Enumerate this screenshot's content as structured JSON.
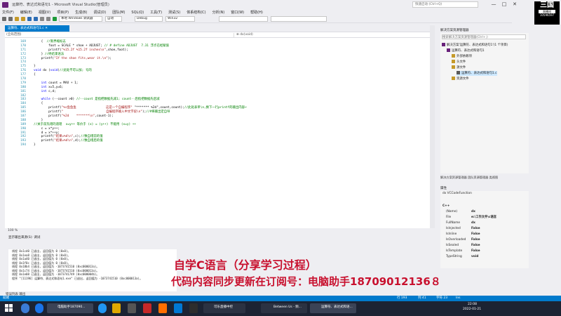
{
  "window": {
    "title": "运算符、表达式和语句1 - Microsoft Visual Studio(管理员)",
    "quick_launch_placeholder": "快速启动 (Ctrl+Q)",
    "min": "—",
    "max": "□",
    "close": "✕"
  },
  "menu": [
    "文件(F)",
    "编辑(E)",
    "视图(V)",
    "项目(P)",
    "生成(B)",
    "调试(D)",
    "团队(M)",
    "SQL(Q)",
    "工具(T)",
    "测试(S)",
    "体系结构(C)",
    "分析(N)",
    "窗口(W)",
    "帮助(H)"
  ],
  "toolbar": {
    "target": "本地 Windows 调试器",
    "mode": "自动",
    "config": "Debug",
    "platform": "Win32"
  },
  "logo": {
    "big": "三国",
    "small": "直播间",
    "num": "10596597"
  },
  "editor": {
    "tab_label": "运算符、表达式和语句1.c ✕",
    "nav_left": "(全局范围)",
    "nav_right": "⊕ dx(void)",
    "zoom": "100 %",
    "lines": [
      {
        "n": "169",
        "segs": [
          {
            "c": "",
            "t": "    {  "
          },
          {
            "c": "cm",
            "t": "//限界缩标志"
          }
        ]
      },
      {
        "n": "170",
        "segs": [
          {
            "c": "",
            "t": "        foot = SCALE * shoe + ADJUST; "
          },
          {
            "c": "cm",
            "t": "// # define ADJUST  7.31 浮点已经赋值"
          }
        ]
      },
      {
        "n": "171",
        "segs": [
          {
            "c": "",
            "t": "        printf("
          },
          {
            "c": "st",
            "t": "\"%15.2f %15.2f inches\\n\""
          },
          {
            "c": "",
            "t": ",shoe,foot);"
          }
        ]
      },
      {
        "n": "172",
        "segs": [
          {
            "c": "",
            "t": "    } "
          },
          {
            "c": "cm",
            "t": "//终结束语法"
          }
        ]
      },
      {
        "n": "173",
        "segs": [
          {
            "c": "",
            "t": "    printf("
          },
          {
            "c": "st",
            "t": "\"If the shoe fits,wear it.\\n\""
          },
          {
            "c": "",
            "t": ");"
          }
        ]
      },
      {
        "n": "174",
        "segs": [
          {
            "c": "",
            "t": ""
          }
        ]
      },
      {
        "n": "175",
        "segs": [
          {
            "c": "",
            "t": "}"
          }
        ]
      },
      {
        "n": "176",
        "segs": [
          {
            "c": "kw",
            "t": "void"
          },
          {
            "c": "",
            "t": " dx ("
          },
          {
            "c": "kw",
            "t": "void"
          },
          {
            "c": "",
            "t": ")"
          },
          {
            "c": "cm",
            "t": "//此处不可以加; 号的"
          }
        ]
      },
      {
        "n": "177",
        "segs": [
          {
            "c": "",
            "t": "{"
          }
        ]
      },
      {
        "n": "178",
        "segs": [
          {
            "c": "",
            "t": ""
          }
        ]
      },
      {
        "n": "179",
        "segs": [
          {
            "c": "",
            "t": "    "
          },
          {
            "c": "kw",
            "t": "int"
          },
          {
            "c": "",
            "t": " count = MAX + 1;"
          }
        ]
      },
      {
        "n": "180",
        "segs": [
          {
            "c": "",
            "t": "    "
          },
          {
            "c": "kw",
            "t": "int"
          },
          {
            "c": "",
            "t": " x=5,y=6;"
          }
        ]
      },
      {
        "n": "181",
        "segs": [
          {
            "c": "",
            "t": "    "
          },
          {
            "c": "kw",
            "t": "int"
          },
          {
            "c": "",
            "t": " c,d;"
          }
        ]
      },
      {
        "n": "182",
        "segs": [
          {
            "c": "",
            "t": ""
          }
        ]
      },
      {
        "n": "183",
        "segs": [
          {
            "c": "",
            "t": "    "
          },
          {
            "c": "kw",
            "t": "while"
          },
          {
            "c": "",
            "t": " (--count >0) "
          },
          {
            "c": "cm",
            "t": "//--count 是指把数据先减1; count--后指把数据先后减"
          }
        ]
      },
      {
        "n": "184",
        "segs": [
          {
            "c": "",
            "t": "    {"
          }
        ]
      },
      {
        "n": "185",
        "segs": [
          {
            "c": "",
            "t": "        printf("
          },
          {
            "c": "st",
            "t": "\"%s鱼鱼鱼                这是一个自编程序\""
          },
          {
            "c": "",
            "t": " \"******* %2d\",count,count);"
          },
          {
            "c": "cm",
            "t": "//此处表单\\n,换下一行printf的输出内容↩"
          }
        ]
      },
      {
        "n": "186",
        "segs": [
          {
            "c": "",
            "t": "        printf("
          },
          {
            "c": "st",
            "t": "\"                       自编程序输入中文字段\\n\""
          },
          {
            "c": "",
            "t": ");"
          },
          {
            "c": "cm",
            "t": "//#将输出定自导"
          }
        ]
      },
      {
        "n": "187",
        "segs": [
          {
            "c": "",
            "t": "        printf("
          },
          {
            "c": "st",
            "t": "\"%2d    *******\\n\""
          },
          {
            "c": "",
            "t": ",count-1);"
          }
        ]
      },
      {
        "n": "188",
        "segs": [
          {
            "c": "",
            "t": "    }"
          }
        ]
      },
      {
        "n": "189",
        "segs": [
          {
            "c": "cm",
            "t": "//关于前先增的道理  x=y++ 等价于 (x) = (y++) 不能用 (x=y) ++"
          }
        ]
      },
      {
        "n": "190",
        "segs": [
          {
            "c": "",
            "t": "    c = x*y++;"
          }
        ]
      },
      {
        "n": "191",
        "segs": [
          {
            "c": "",
            "t": "    d = x*++y;"
          }
        ]
      },
      {
        "n": "192",
        "segs": [
          {
            "c": "",
            "t": "    printf("
          },
          {
            "c": "st",
            "t": "\"结果=%d\\n\""
          },
          {
            "c": "",
            "t": ",c);"
          },
          {
            "c": "cm",
            "t": "//数自增前的值"
          }
        ]
      },
      {
        "n": "193",
        "segs": [
          {
            "c": "",
            "t": "    printf("
          },
          {
            "c": "st",
            "t": "\"结果=%d\\n\""
          },
          {
            "c": "",
            "t": ",d);"
          },
          {
            "c": "cm",
            "t": "//数自增后的值"
          }
        ]
      },
      {
        "n": "194",
        "segs": [
          {
            "c": "",
            "t": "}"
          }
        ]
      }
    ]
  },
  "output": {
    "title": "显示输出来源(S): 调试",
    "source": "调试",
    "lines": [
      "线程 0x1cd0 已退出, 返回值为 0 (0x0)。",
      "线程 0x1ea8 已退出, 返回值为 0 (0x0)。",
      "线程 0x1a40 已退出, 返回值为 0 (0x0)。",
      "线程 0x1f0c 已退出, 返回值为 0 (0x0)。",
      "线程 0x18b4 已退出, 返回值为 -1073741510 (0xc000013a)。",
      "线程 0x1c74 已退出, 返回值为 -1073741510 (0xc000013a)。",
      "线程 0x1e08 已退出, 返回值为 -1073741749 (0xc000004b)。",
      "程序 \"[11196] 运算符、表达式和语句1.exe\" 已退出, 返回值为 -1073741510 (0xc000013a)。"
    ],
    "tabs": "错误列表  输出"
  },
  "solution": {
    "header": "解决方案资源管理器",
    "search": "搜索解决方案资源管理器(Ctrl+;)",
    "items": [
      {
        "label": "解决方案'运算符、表达式和语句1'(1 个项目)",
        "indent": 0,
        "color": "#68217a"
      },
      {
        "label": "运算符、表达式和语句1",
        "indent": 1,
        "color": "#68217a"
      },
      {
        "label": "外部依赖项",
        "indent": 2,
        "color": "#c59a2a"
      },
      {
        "label": "头文件",
        "indent": 2,
        "color": "#c59a2a"
      },
      {
        "label": "源文件",
        "indent": 2,
        "color": "#c59a2a"
      },
      {
        "label": "运算符、表达式和语句1.c",
        "indent": 3,
        "color": "#5a5a5a",
        "selected": true
      },
      {
        "label": "资源文件",
        "indent": 2,
        "color": "#c59a2a"
      }
    ],
    "tabs": "解决方案资源管理器  团队资源管理器  类视图"
  },
  "properties": {
    "header": "属性",
    "object": "dx VCCodeFunction",
    "category": "C++",
    "rows": [
      {
        "k": "(Name)",
        "v": "dx"
      },
      {
        "k": "File",
        "v": "e:\\工作文件\\c语言"
      },
      {
        "k": "FullName",
        "v": "dx"
      },
      {
        "k": "IsInjected",
        "v": "False"
      },
      {
        "k": "IsInline",
        "v": "False"
      },
      {
        "k": "IsOverloaded",
        "v": "False"
      },
      {
        "k": "IsSealed",
        "v": "False"
      },
      {
        "k": "IsTemplate",
        "v": "False"
      },
      {
        "k": "TypeString",
        "v": "void"
      }
    ]
  },
  "statusbar": {
    "left": "就绪",
    "line": "行 193",
    "col": "列 41",
    "ch": "字符 23",
    "ins": "Ins"
  },
  "taskbar": {
    "items": [
      {
        "label": "电脑助手187090..."
      },
      {
        "label": "可乐直播中控"
      },
      {
        "label": "Between Us - 频..."
      },
      {
        "label": "运算符、表达式和语..."
      }
    ],
    "time": "22:08",
    "date": "2022-01-21"
  },
  "overlay": {
    "line1": "自学C语言（分享学习过程）",
    "line2": "代码内容同步更新在订阅号：电脑助手18709012136８"
  }
}
